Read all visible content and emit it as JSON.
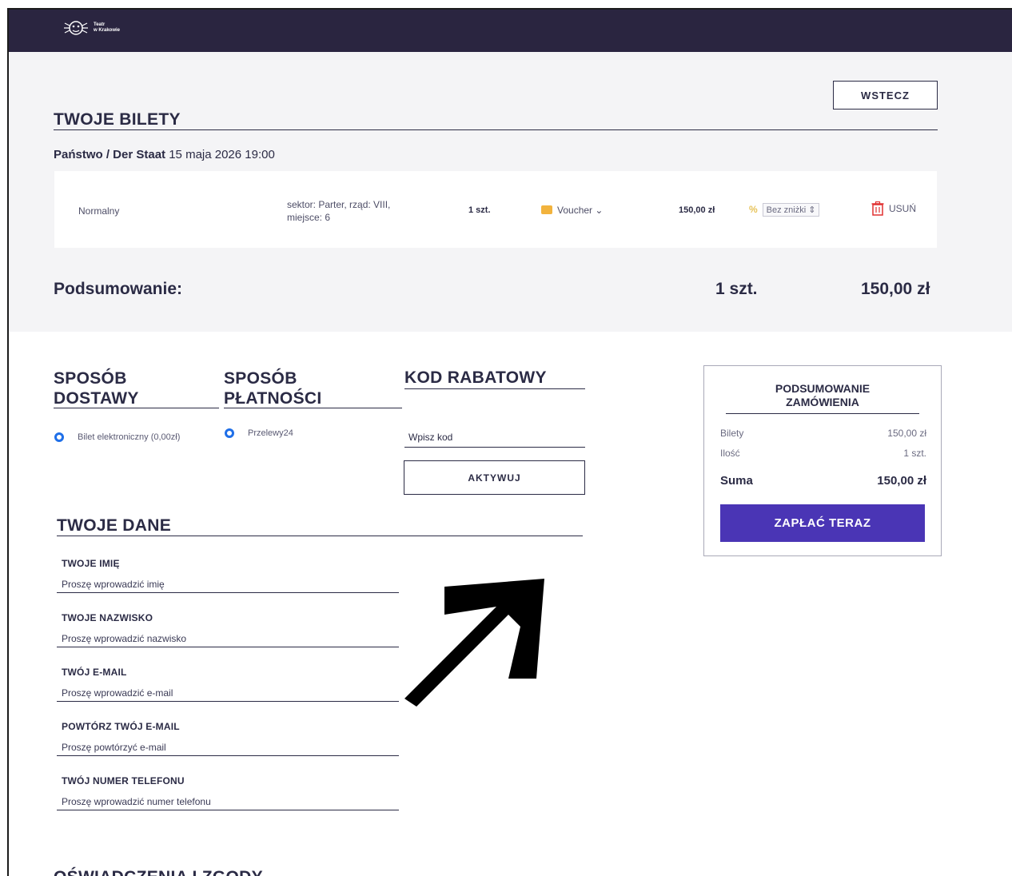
{
  "header": {
    "logo_line1": "Teatr",
    "logo_line2": "w Krakowie"
  },
  "back_button": "WSTECZ",
  "tickets": {
    "title": "TWOJE BILETY",
    "event_name": "Państwo / Der Staat",
    "event_date": "15 maja 2026 19:00",
    "row": {
      "type": "Normalny",
      "seat_line1": "sektor: Parter, rząd: VIII,",
      "seat_line2": "miejsce: 6",
      "qty": "1 szt.",
      "voucher": "Voucher ⌄",
      "price": "150,00 zł",
      "discount": "Bez zniżki ⇕",
      "remove": "USUŃ"
    }
  },
  "summary": {
    "label": "Podsumowanie:",
    "qty": "1 szt.",
    "total": "150,00 zł"
  },
  "delivery": {
    "title_line1": "SPOSÓB",
    "title_line2": "DOSTAWY",
    "option": "Bilet elektroniczny (0,00zł)"
  },
  "payment": {
    "title_line1": "SPOSÓB",
    "title_line2": "PŁATNOŚCI",
    "option": "Przelewy24"
  },
  "discount_code": {
    "title": "KOD RABATOWY",
    "placeholder": "Wpisz kod",
    "button": "AKTYWUJ"
  },
  "order_summary": {
    "title_line1": "PODSUMOWANIE",
    "title_line2": "ZAMÓWIENIA",
    "tickets_label": "Bilety",
    "tickets_value": "150,00 zł",
    "qty_label": "Ilość",
    "qty_value": "1 szt.",
    "sum_label": "Suma",
    "sum_value": "150,00 zł",
    "pay_button": "ZAPŁAĆ TERAZ"
  },
  "your_data": {
    "title": "TWOJE DANE",
    "fields": [
      {
        "label": "TWOJE IMIĘ",
        "placeholder": "Proszę wprowadzić imię"
      },
      {
        "label": "TWOJE NAZWISKO",
        "placeholder": "Proszę wprowadzić nazwisko"
      },
      {
        "label": "TWÓJ E-MAIL",
        "placeholder": "Proszę wprowadzić e-mail"
      },
      {
        "label": "POWTÓRZ TWÓJ E-MAIL",
        "placeholder": "Proszę powtórzyć e-mail"
      },
      {
        "label": "TWÓJ NUMER TELEFONU",
        "placeholder": "Proszę wprowadzić numer telefonu"
      }
    ]
  },
  "consents": {
    "title": "OŚWIADCZENIA I ZGODY"
  },
  "colors": {
    "header_bg": "#2a2540",
    "primary_button": "#4a35b5",
    "radio": "#1f6fe8",
    "delete_red": "#e03030",
    "voucher_yellow": "#f2b33d"
  },
  "icons": [
    "logo-mask-icon",
    "voucher-icon",
    "discount-icon",
    "trash-icon",
    "arrow-annotation-icon"
  ]
}
